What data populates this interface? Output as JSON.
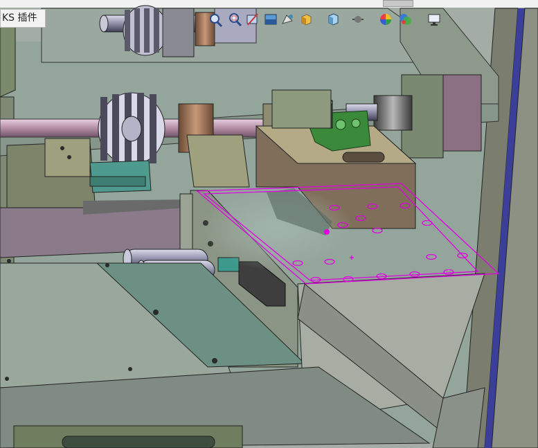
{
  "plugin_tab": {
    "label": "KS 插件"
  },
  "toolbar_icons": [
    "zoom-to-fit-icon",
    "zoom-area-icon",
    "previous-view-icon",
    "section-view-icon",
    "dynamic-annotation-icon",
    "view-orientation-icon",
    "display-style-icon",
    "hide-show-icon",
    "edit-appearance-icon",
    "apply-scene-icon",
    "view-settings-icon"
  ],
  "colors": {
    "background": "#8d9a92",
    "highlight_edges": "#e000e0",
    "frame_rail": "#3c3f9a"
  }
}
